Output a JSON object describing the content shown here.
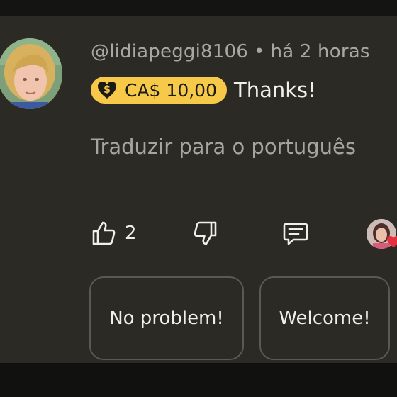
{
  "comment": {
    "username": "@lidiapeggi8106",
    "separator": "•",
    "timestamp": "há 2 horas",
    "super_thanks_amount": "CA$ 10,00",
    "text": "Thanks!",
    "translate_label": "Traduzir para o português"
  },
  "actions": {
    "like_count": "2"
  },
  "suggested_replies": [
    "No problem!",
    "Welcome!"
  ],
  "colors": {
    "background": "#2c2a25",
    "badge": "#f7c948",
    "heart": "#e5303d"
  },
  "icons": {
    "like": "thumb-up-icon",
    "dislike": "thumb-down-icon",
    "reply": "reply-comment-icon",
    "super_thanks": "super-thanks-heart-dollar-icon",
    "creator_heart": "heart-icon"
  }
}
